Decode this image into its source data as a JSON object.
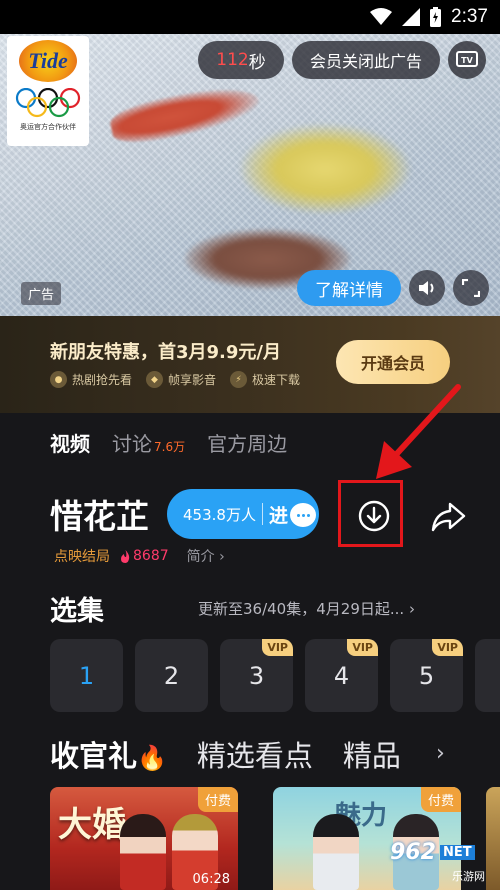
{
  "status_bar": {
    "time": "2:37"
  },
  "ad": {
    "brand_name": "Tide",
    "brand_caption": "奥运官方合作伙伴",
    "countdown_value": "112",
    "countdown_unit": "秒",
    "member_close_label": "会员关闭此广告",
    "ad_label": "广告",
    "learn_more_label": "了解详情"
  },
  "member_banner": {
    "title": "新朋友特惠，首3月9.9元/月",
    "perks": [
      "热剧抢先看",
      "帧享影音",
      "极速下载"
    ],
    "button_label": "开通会员"
  },
  "tabs": [
    {
      "label": "视频",
      "active": true
    },
    {
      "label": "讨论",
      "count": "7.6万"
    },
    {
      "label": "官方周边"
    }
  ],
  "show": {
    "title": "惜花芷",
    "heat_count": "453.8万人",
    "heat_enter": "进",
    "ending_label": "点映结局",
    "fire_count": "8687",
    "intro_label": "简介"
  },
  "episodes": {
    "heading": "选集",
    "update_text": "更新至36/40集，4月29日起...",
    "items": [
      {
        "num": "1",
        "vip": ""
      },
      {
        "num": "2",
        "vip": ""
      },
      {
        "num": "3",
        "vip": "VIP"
      },
      {
        "num": "4",
        "vip": "VIP"
      },
      {
        "num": "5",
        "vip": "VIP"
      }
    ]
  },
  "highlights": {
    "tabs": [
      "收官礼",
      "精选看点",
      "精品"
    ],
    "thumbs": [
      {
        "tag": "付费",
        "duration": "06:28",
        "title": "大婚"
      },
      {
        "tag": "付费",
        "duration": "",
        "title": "魅力"
      }
    ]
  },
  "watermark": {
    "number": "962",
    "net": "NET",
    "sub": "乐游网"
  },
  "colors": {
    "accent_blue": "#2aa2f5",
    "annotation_red": "#e3171b",
    "vip_gold": "#f6cf7f"
  }
}
